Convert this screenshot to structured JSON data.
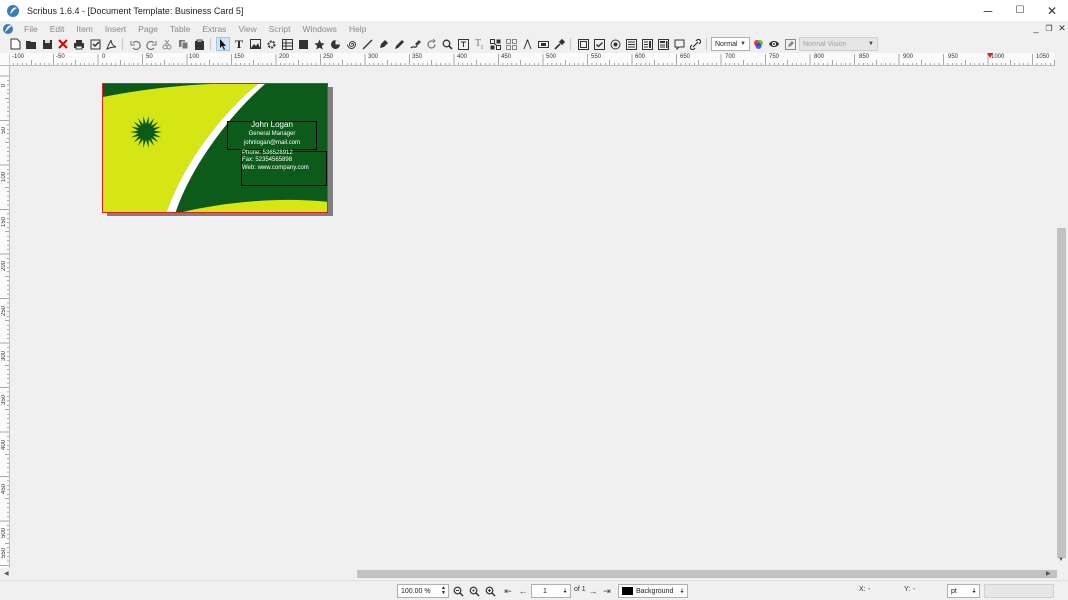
{
  "window": {
    "title": "Scribus 1.6.4 - [Document Template: Business Card 5]",
    "minimize": "─",
    "maximize": "☐",
    "close": "✕"
  },
  "menu": [
    "File",
    "Edit",
    "Item",
    "Insert",
    "Page",
    "Table",
    "Extras",
    "View",
    "Script",
    "Windows",
    "Help"
  ],
  "toolbar": {
    "mode_combo": "Normal",
    "vision_combo": "Normal Vision"
  },
  "rulers": {
    "horizontal": [
      "-100",
      "-50",
      "0",
      "50",
      "100",
      "150",
      "200",
      "250",
      "300",
      "350",
      "400",
      "450",
      "500",
      "550",
      "600",
      "650",
      "700",
      "750",
      "800",
      "850",
      "900",
      "950",
      "1000",
      "1050"
    ],
    "vertical": [
      "0",
      "50",
      "100",
      "150",
      "200",
      "250",
      "300",
      "350",
      "400",
      "450",
      "500",
      "550"
    ]
  },
  "card": {
    "name": "John Logan",
    "job_title": "General Manager",
    "email": "johnlogan@mail.com",
    "phone": "Phone: 536528912",
    "fax": "Fax: 52354565898",
    "web": "Web: www.company.com",
    "colors": {
      "green": "#0c5b1a",
      "yellow": "#d5e614",
      "white": "#ffffff"
    }
  },
  "status": {
    "zoom": "100.00 %",
    "page": "1",
    "page_of": "of 1",
    "layer": "Background",
    "x_label": "X:",
    "x_value": "-",
    "y_label": "Y:",
    "y_value": "-",
    "unit": "pt"
  }
}
